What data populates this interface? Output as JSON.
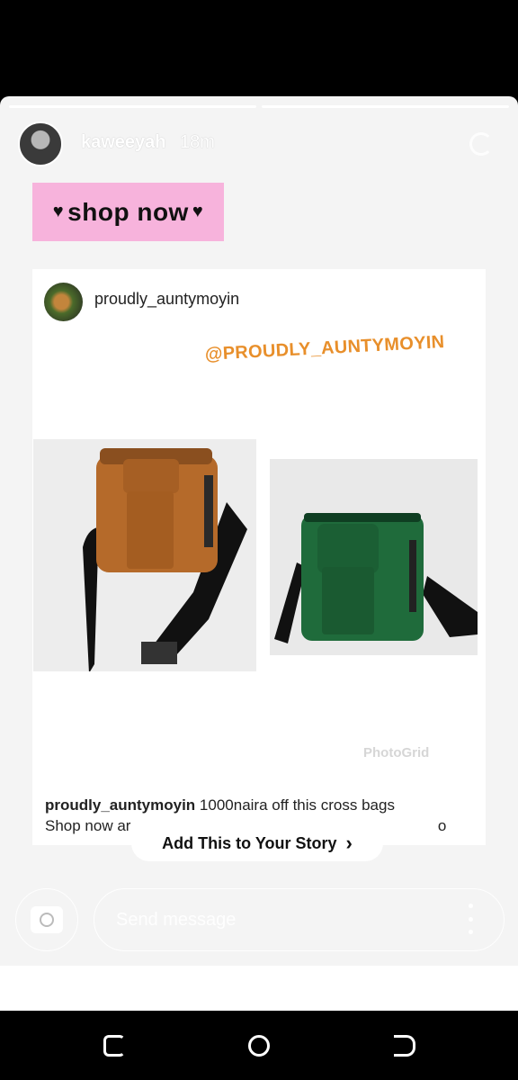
{
  "story": {
    "username": "kaweeyah",
    "time_ago": "18m",
    "sticker_text": "shop now",
    "mention_text": "@PROUDLY_AUNTYMOYIN",
    "watermark": "PhotoGrid",
    "add_to_story": "Add This to Your Story"
  },
  "post": {
    "username": "proudly_auntymoyin",
    "caption_user": "proudly_auntymoyin",
    "caption_text": "1000naira off this cross bags",
    "caption_line2_left": "Shop now ar",
    "caption_line2_right": "o"
  },
  "reply": {
    "placeholder": "Send message"
  },
  "colors": {
    "sticker_bg": "#f7b3dc",
    "mention": "#e88f2b",
    "bag_left": "#b56a2a",
    "bag_right": "#1f6b3b"
  },
  "icons": {
    "camera": "camera-icon",
    "more": "more-vertical-icon",
    "chevron": "chevron-right-icon"
  }
}
